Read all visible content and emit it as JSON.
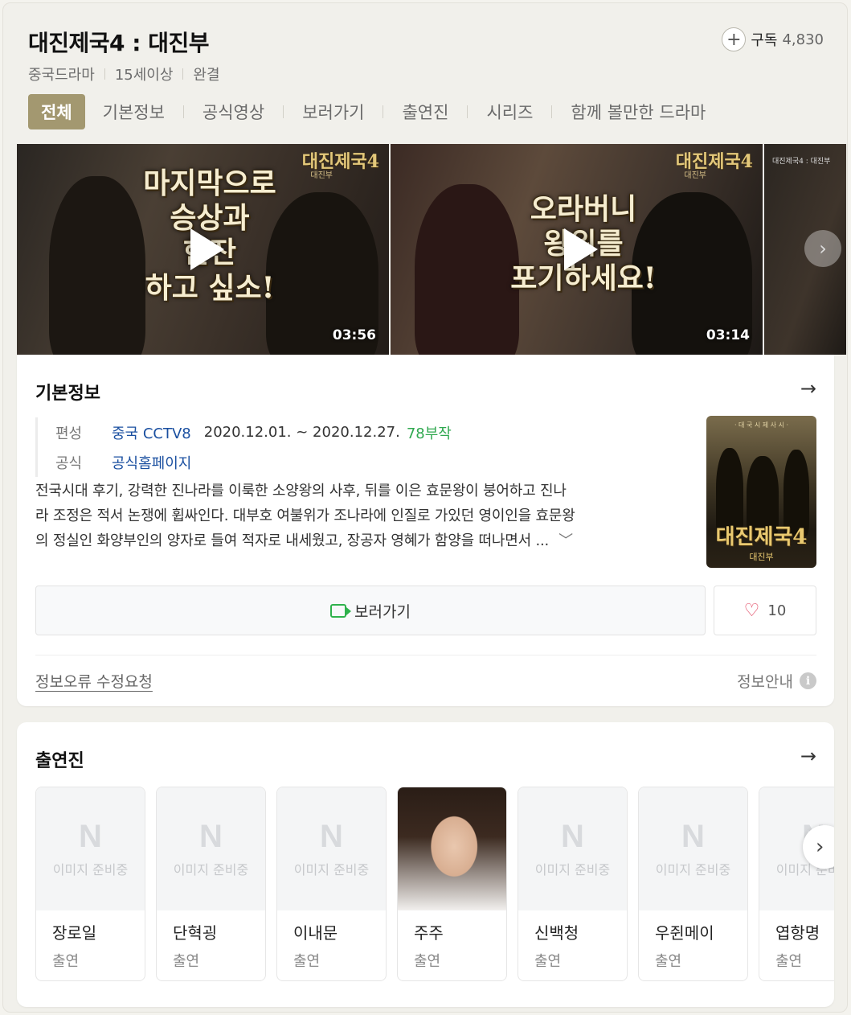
{
  "header": {
    "title": "대진제국4 : 대진부",
    "subscribe_label": "구독",
    "subscribe_count": "4,830",
    "meta": [
      "중국드라마",
      "15세이상",
      "완결"
    ]
  },
  "tabs": [
    "전체",
    "기본정보",
    "공식영상",
    "보러가기",
    "출연진",
    "시리즈",
    "함께 볼만한 드라마"
  ],
  "videos": [
    {
      "caption_lines": [
        "마지막으로",
        "승상과",
        "한잔",
        "하고 싶소!"
      ],
      "brand": "대진제국4",
      "brand_sub": "대진부",
      "duration": "03:56"
    },
    {
      "caption_lines": [
        "오라버니",
        "왕위를",
        "포기하세요!"
      ],
      "brand": "대진제국4",
      "brand_sub": "대진부",
      "duration": "03:14"
    },
    {
      "brand": "대진제국4 : 대진부"
    }
  ],
  "basic_info": {
    "title": "기본정보",
    "broadcast_label": "편성",
    "broadcast_channel": "중국 CCTV8",
    "broadcast_dates": "2020.12.01. ~ 2020.12.27.",
    "episodes": "78부작",
    "official_label": "공식",
    "official_link": "공식홈페이지",
    "synopsis_lines": [
      "전국시대 후기, 강력한 진나라를 이룩한 소양왕의 사후, 뒤를 이은 효문왕이 붕어하고 진나",
      "라 조정은 적서 논쟁에 휩싸인다. 대부호 여불위가 조나라에 인질로 가있던 영이인을 효문왕",
      "의 정실인 화양부인의 양자로 들여 적자로 내세웠고, 장공자 영혜가 함양을 떠나면서 ..."
    ],
    "poster_top": "· 대 국 시 제 사 시 ·",
    "poster_title": "대진제국4",
    "poster_subtitle": "대진부",
    "watch_label": "보러가기",
    "like_count": "10",
    "error_report": "정보오류 수정요청",
    "info_guide": "정보안내"
  },
  "cast": {
    "title": "출연진",
    "placeholder_text": "이미지 준비중",
    "members": [
      {
        "name": "장로일",
        "role": "출연",
        "has_photo": false
      },
      {
        "name": "단혁굉",
        "role": "출연",
        "has_photo": false
      },
      {
        "name": "이내문",
        "role": "출연",
        "has_photo": false
      },
      {
        "name": "주주",
        "role": "출연",
        "has_photo": true
      },
      {
        "name": "신백청",
        "role": "출연",
        "has_photo": false
      },
      {
        "name": "우쥔메이",
        "role": "출연",
        "has_photo": false
      },
      {
        "name": "엽항명",
        "role": "출연",
        "has_photo": false
      }
    ]
  },
  "colors": {
    "accent": "#a39870",
    "link": "#1a4fa0",
    "episodes": "#2fa84f",
    "heart": "#e0415d"
  },
  "icons": [
    "plus-icon",
    "play-icon",
    "chevron-right-icon",
    "arrow-right-icon",
    "chevron-down-icon",
    "video-camera-icon",
    "heart-icon",
    "info-icon"
  ]
}
